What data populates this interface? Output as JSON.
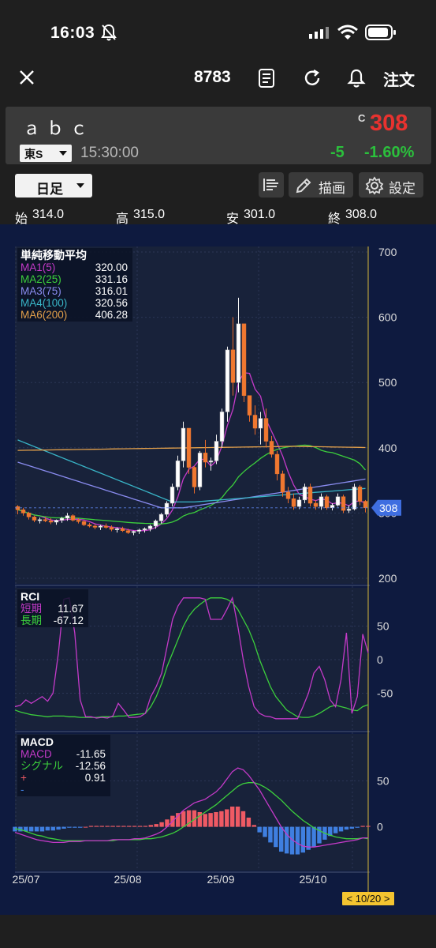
{
  "status": {
    "time": "16:03",
    "icons": [
      "bell-off-icon",
      "signal-icon",
      "wifi-icon",
      "battery-icon"
    ]
  },
  "header": {
    "code": "8783",
    "order_label": "注文",
    "icons": [
      "close-icon",
      "document-icon",
      "refresh-icon",
      "bell-icon"
    ]
  },
  "quote": {
    "name": "ａｂｃ",
    "market": "東S",
    "time": "15:30:00",
    "close_mark": "C",
    "price": "308",
    "change": "-5",
    "change_pct": "-1.60%",
    "colors": {
      "up": "#e8322f",
      "down": "#2bc03c"
    }
  },
  "toolbar": {
    "period": "日足",
    "draw_label": "描画",
    "settings_label": "設定"
  },
  "ohlc": {
    "open_label": "始",
    "open": "314.0",
    "high_label": "高",
    "high": "315.0",
    "low_label": "安",
    "low": "301.0",
    "close_label": "終",
    "close": "308.0"
  },
  "chart_data": [
    {
      "type": "line",
      "panel": "price",
      "legend_title": "単純移動平均",
      "series": [
        {
          "name": "MA1(5)",
          "last": "320.00",
          "color": "#c43ac8"
        },
        {
          "name": "MA2(25)",
          "last": "331.16",
          "color": "#3ccf3c"
        },
        {
          "name": "MA3(75)",
          "last": "316.01",
          "color": "#8a8cf0"
        },
        {
          "name": "MA4(100)",
          "last": "320.56",
          "color": "#39b6c8"
        },
        {
          "name": "MA6(200)",
          "last": "406.28",
          "color": "#e3a04a"
        }
      ],
      "y_ticks": [
        "700",
        "600",
        "500",
        "400",
        "300",
        "200"
      ],
      "ylim": [
        200,
        700
      ],
      "current_price_label": "308",
      "candles": [
        [
          310,
          312,
          298,
          305
        ],
        [
          305,
          308,
          296,
          300
        ],
        [
          300,
          302,
          290,
          294
        ],
        [
          294,
          296,
          286,
          289
        ],
        [
          289,
          293,
          284,
          290
        ],
        [
          290,
          294,
          286,
          288
        ],
        [
          288,
          292,
          283,
          286
        ],
        [
          286,
          290,
          282,
          289
        ],
        [
          289,
          294,
          285,
          292
        ],
        [
          292,
          300,
          288,
          296
        ],
        [
          296,
          298,
          287,
          289
        ],
        [
          289,
          292,
          284,
          287
        ],
        [
          287,
          289,
          280,
          282
        ],
        [
          282,
          285,
          278,
          280
        ],
        [
          280,
          283,
          275,
          279
        ],
        [
          279,
          282,
          274,
          280
        ],
        [
          280,
          284,
          276,
          278
        ],
        [
          278,
          281,
          272,
          275
        ],
        [
          275,
          278,
          270,
          276
        ],
        [
          276,
          279,
          271,
          273
        ],
        [
          273,
          276,
          268,
          270
        ],
        [
          270,
          273,
          266,
          272
        ],
        [
          272,
          276,
          268,
          274
        ],
        [
          274,
          278,
          270,
          276
        ],
        [
          276,
          282,
          272,
          280
        ],
        [
          280,
          290,
          276,
          288
        ],
        [
          288,
          300,
          284,
          298
        ],
        [
          298,
          318,
          294,
          315
        ],
        [
          315,
          345,
          310,
          340
        ],
        [
          340,
          388,
          335,
          380
        ],
        [
          380,
          440,
          370,
          430
        ],
        [
          430,
          400,
          360,
          370
        ],
        [
          370,
          372,
          330,
          340
        ],
        [
          340,
          395,
          335,
          392
        ],
        [
          392,
          412,
          370,
          378
        ],
        [
          378,
          385,
          365,
          380
        ],
        [
          380,
          420,
          375,
          410
        ],
        [
          410,
          460,
          400,
          455
        ],
        [
          455,
          555,
          440,
          550
        ],
        [
          550,
          600,
          480,
          500
        ],
        [
          500,
          630,
          485,
          590
        ],
        [
          590,
          560,
          470,
          480
        ],
        [
          480,
          470,
          440,
          450
        ],
        [
          450,
          465,
          420,
          430
        ],
        [
          430,
          455,
          405,
          445
        ],
        [
          445,
          460,
          400,
          410
        ],
        [
          410,
          418,
          385,
          390
        ],
        [
          390,
          395,
          350,
          360
        ],
        [
          360,
          365,
          325,
          332
        ],
        [
          332,
          340,
          315,
          322
        ],
        [
          322,
          330,
          305,
          310
        ],
        [
          310,
          325,
          306,
          320
        ],
        [
          320,
          345,
          315,
          340
        ],
        [
          340,
          345,
          310,
          315
        ],
        [
          315,
          320,
          305,
          310
        ],
        [
          310,
          330,
          305,
          325
        ],
        [
          325,
          328,
          305,
          308
        ],
        [
          308,
          315,
          304,
          312
        ],
        [
          312,
          330,
          310,
          325
        ],
        [
          325,
          328,
          300,
          304
        ],
        [
          304,
          312,
          300,
          306
        ],
        [
          306,
          345,
          304,
          340
        ],
        [
          340,
          343,
          312,
          318
        ],
        [
          318,
          320,
          301,
          308
        ]
      ]
    },
    {
      "type": "line",
      "panel": "RCI",
      "legend_title": "RCI",
      "series": [
        {
          "name": "短期",
          "last": "11.67",
          "color": "#c43ac8"
        },
        {
          "name": "長期",
          "last": "-67.12",
          "color": "#3ccf3c"
        }
      ],
      "y_ticks": [
        "50",
        "0",
        "-50"
      ],
      "ylim": [
        -100,
        100
      ],
      "short": [
        -70,
        -68,
        -60,
        -65,
        -60,
        -55,
        -62,
        -50,
        10,
        90,
        92,
        40,
        -60,
        -85,
        -85,
        -87,
        -86,
        -87,
        -84,
        -65,
        -75,
        -86,
        -86,
        -85,
        -80,
        -55,
        -40,
        -20,
        20,
        60,
        80,
        92,
        92,
        92,
        92,
        90,
        60,
        60,
        60,
        75,
        92,
        50,
        0,
        -40,
        -70,
        -80,
        -84,
        -85,
        -88,
        -88,
        -88,
        -88,
        -88,
        -70,
        -50,
        -20,
        -10,
        -30,
        -60,
        -70,
        -30,
        40,
        -80,
        -55,
        38,
        10
      ],
      "long": [
        -75,
        -78,
        -80,
        -82,
        -83,
        -84,
        -85,
        -84,
        -84,
        -84,
        -85,
        -85,
        -86,
        -86,
        -86,
        -86,
        -85,
        -85,
        -85,
        -84,
        -84,
        -83,
        -82,
        -81,
        -80,
        -70,
        -55,
        -35,
        -10,
        10,
        30,
        50,
        65,
        75,
        82,
        88,
        92,
        92,
        92,
        90,
        85,
        75,
        60,
        45,
        25,
        0,
        -20,
        -40,
        -55,
        -65,
        -75,
        -80,
        -85,
        -86,
        -86,
        -84,
        -80,
        -75,
        -70,
        -68,
        -70,
        -72,
        -75,
        -76,
        -70,
        -67
      ]
    },
    {
      "type": "bar",
      "panel": "MACD",
      "legend_title": "MACD",
      "series": [
        {
          "name": "MACD",
          "last": "-11.65",
          "color": "#c43ac8"
        },
        {
          "name": "シグナル",
          "last": "-12.56",
          "color": "#3ccf3c"
        },
        {
          "name": "+",
          "last": "0.91",
          "color": "#ef5a64"
        },
        {
          "name": "-",
          "last": "",
          "color": "#3f7fe0"
        }
      ],
      "y_ticks": [
        "50",
        "0"
      ],
      "ylim": [
        -45,
        95
      ],
      "macd": [
        -6,
        -8,
        -10,
        -12,
        -14,
        -15,
        -16,
        -17,
        -17,
        -17,
        -16,
        -16,
        -16,
        -15,
        -15,
        -15,
        -15,
        -15,
        -14,
        -14,
        -14,
        -14,
        -13,
        -13,
        -12,
        -10,
        -8,
        -5,
        0,
        6,
        12,
        18,
        22,
        26,
        28,
        30,
        34,
        38,
        44,
        52,
        60,
        64,
        62,
        56,
        48,
        40,
        30,
        20,
        10,
        0,
        -8,
        -14,
        -18,
        -21,
        -22,
        -22,
        -21,
        -20,
        -19,
        -18,
        -17,
        -16,
        -15,
        -14,
        -12,
        -12
      ],
      "signal": [
        -2,
        -3,
        -5,
        -7,
        -9,
        -10,
        -12,
        -13,
        -14,
        -15,
        -15,
        -15,
        -15,
        -15,
        -15,
        -15,
        -15,
        -15,
        -15,
        -14,
        -14,
        -14,
        -14,
        -14,
        -13,
        -13,
        -12,
        -11,
        -9,
        -7,
        -4,
        0,
        4,
        8,
        12,
        16,
        20,
        24,
        29,
        34,
        39,
        44,
        47,
        48,
        48,
        46,
        43,
        39,
        34,
        29,
        23,
        17,
        12,
        7,
        3,
        -1,
        -4,
        -7,
        -9,
        -11,
        -12,
        -13,
        -13,
        -13,
        -12,
        -13
      ],
      "hist": [
        -5,
        -5,
        -5,
        -5,
        -5,
        -5,
        -4,
        -4,
        -3,
        -2,
        -1,
        -1,
        -1,
        0,
        1,
        1,
        1,
        1,
        1,
        1,
        1,
        1,
        1,
        1,
        1,
        2,
        3,
        5,
        8,
        12,
        15,
        17,
        18,
        18,
        16,
        14,
        15,
        16,
        17,
        19,
        22,
        22,
        17,
        10,
        2,
        -6,
        -11,
        -17,
        -22,
        -27,
        -29,
        -30,
        -30,
        -28,
        -25,
        -22,
        -18,
        -14,
        -10,
        -7,
        -5,
        -3,
        -2,
        -1,
        1,
        1
      ]
    }
  ],
  "x_ticks": [
    "25/07",
    "25/08",
    "25/09",
    "25/10"
  ],
  "cursor_label": "< 10/20 >"
}
